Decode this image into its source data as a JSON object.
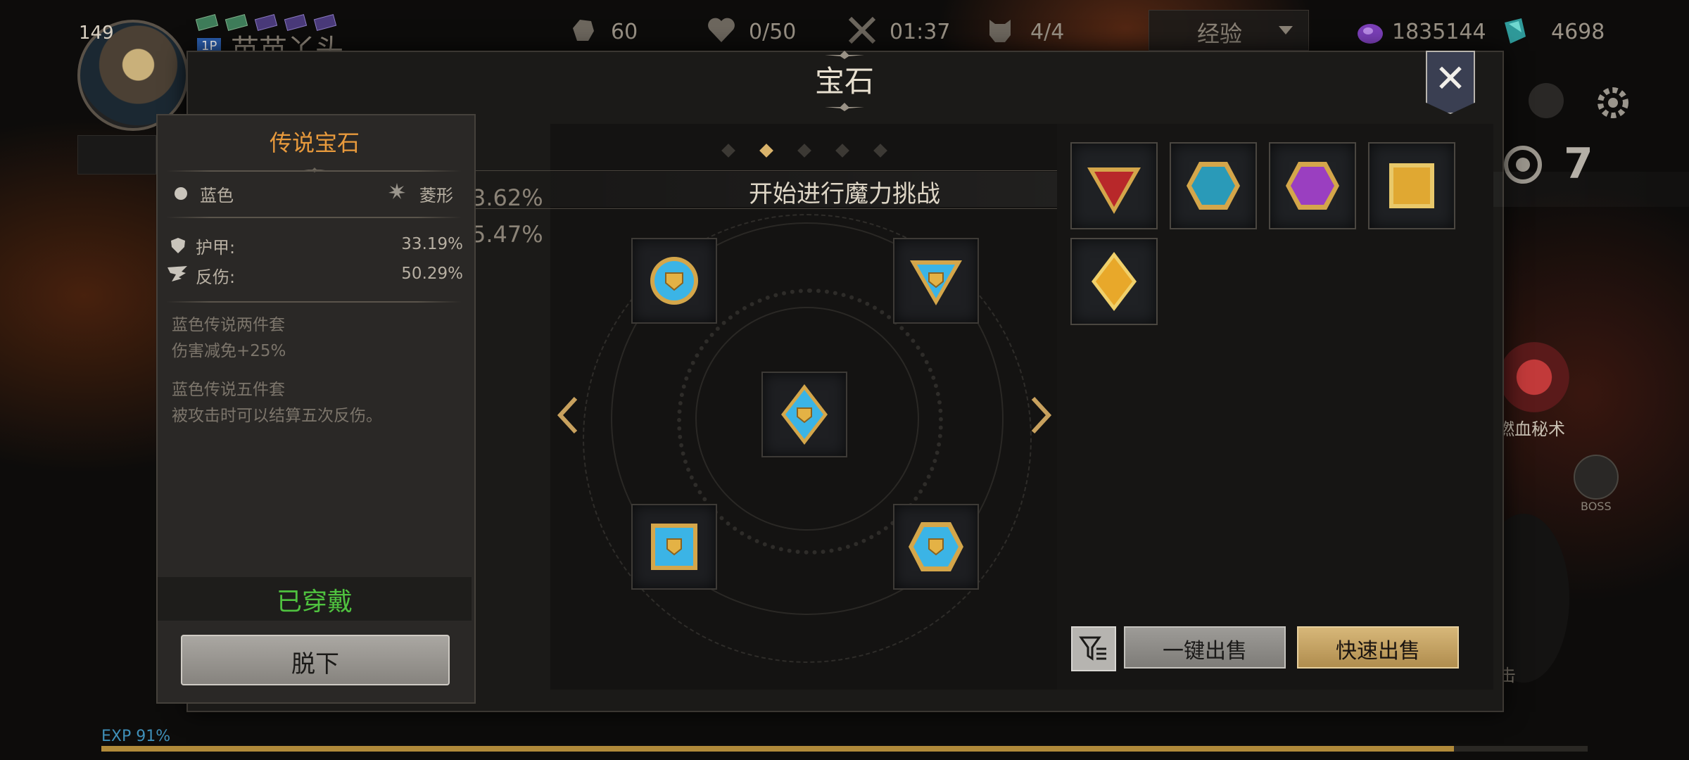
{
  "hud": {
    "level": "149",
    "player_tag": "1P",
    "player_name": "苗苗丫头",
    "stamina": "60",
    "hearts": "0/50",
    "timer": "01:37",
    "boss_count": "4/4",
    "exp_dropdown": "经验",
    "purple_currency": "1835144",
    "teal_currency": "4698"
  },
  "dialog": {
    "title": "宝石",
    "close_label": "✕"
  },
  "background_stats": [
    "3.62%",
    "5.47%"
  ],
  "detail": {
    "title": "传说宝石",
    "color_label": "蓝色",
    "shape_label": "菱形",
    "attributes": [
      {
        "name": "护甲:",
        "value": "33.19%"
      },
      {
        "name": "反伤:",
        "value": "50.29%"
      }
    ],
    "set_bonus_1_title": "蓝色传说两件套",
    "set_bonus_1_desc": "伤害减免+25%",
    "set_bonus_2_title": "蓝色传说五件套",
    "set_bonus_2_desc": "被攻击时可以结算五次反伤。",
    "status": "已穿戴",
    "unequip_label": "脱下"
  },
  "socket": {
    "page_count": 5,
    "active_page": 2,
    "challenge_label": "开始进行魔力挑战"
  },
  "inventory": {
    "gems": [
      "red-triangle",
      "teal-hexagon",
      "purple-hexagon",
      "gold-square",
      "gold-diamond"
    ],
    "sell_all_label": "一键出售",
    "quick_sell_label": "快速出售"
  },
  "side_hud": {
    "skill_label": "燃血秘术",
    "boss_label": "BOSS",
    "quick_number": "7",
    "attack_label": "击"
  },
  "exp": {
    "label": "EXP 91%",
    "fraction": 0.91
  },
  "colors": {
    "accent_gold": "#d9b36b",
    "title_orange": "#e89a3c",
    "equipped_green": "#4fc23f",
    "exp_blue": "#3f8fb8"
  }
}
